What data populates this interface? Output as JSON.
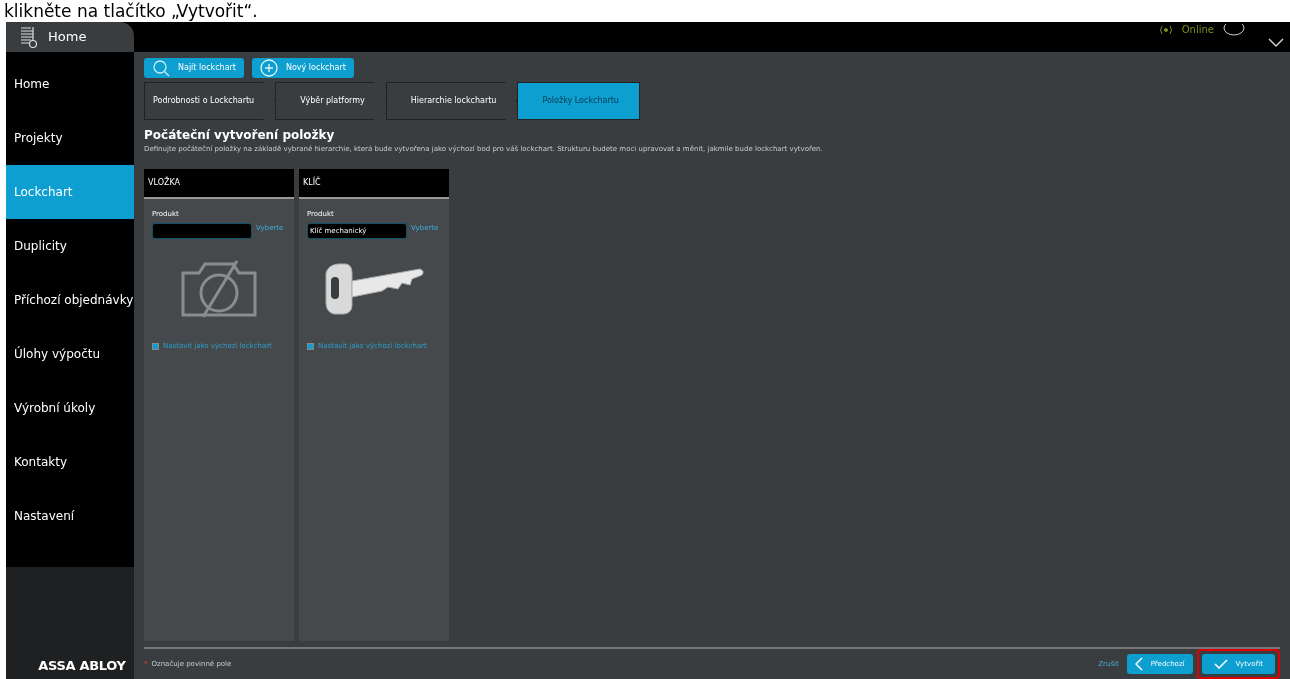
{
  "caption": "klikněte na tlačítko „Vytvořit“.",
  "header": {
    "tab": "Home",
    "status": "Online"
  },
  "sidebar": {
    "items": [
      {
        "label": "Home",
        "selected": false
      },
      {
        "label": "Projekty",
        "selected": false
      },
      {
        "label": "Lockchart",
        "selected": true
      },
      {
        "label": "Duplicity",
        "selected": false
      },
      {
        "label": "Příchozí objednávky",
        "selected": false
      },
      {
        "label": "Úlohy výpočtu",
        "selected": false
      },
      {
        "label": "Výrobní úkoly",
        "selected": false
      },
      {
        "label": "Kontakty",
        "selected": false
      },
      {
        "label": "Nastavení",
        "selected": false
      }
    ],
    "logo": "ASSA ABLOY"
  },
  "toolbar": [
    {
      "kind": "search",
      "label": "Najít lockchart"
    },
    {
      "kind": "add",
      "label": "Nový lockchart"
    }
  ],
  "steps": [
    {
      "label": "Podrobnosti o Lockchartu",
      "selected": false
    },
    {
      "label": "Výběr platformy",
      "selected": false
    },
    {
      "label": "Hierarchie lockchartu",
      "selected": false
    },
    {
      "label": "Položky Lockchartu",
      "selected": true
    }
  ],
  "heading": "Počáteční vytvoření položky",
  "description": "Definujte počáteční položky na základě vybrané hierarchie, která bude vytvořena jako výchozí bod pro váš lockchart. Strukturu budete moci upravovat a měnit, jakmile bude lockchart vytvořen.",
  "cards": [
    {
      "kind": "no-photo",
      "title": "VLOŽKA",
      "field_label": "Produkt",
      "link": "Vyberte",
      "checkbox": {
        "label": "Nastavit jako výchozí lockchart",
        "checked": true
      }
    },
    {
      "kind": "key",
      "title": "KLÍČ",
      "field_label": "Produkt",
      "value": "Klíč mechanický",
      "link": "Vyberte",
      "checkbox": {
        "label": "Nastavit jako výchozí lockchart",
        "checked": true
      }
    }
  ],
  "footer": {
    "required_mark": "*",
    "required_note": "Označuje povinné pole",
    "cancel": "Zrušit",
    "previous": "Předchozí",
    "create": {
      "label": "Vytvořit",
      "highlighted": true
    }
  }
}
